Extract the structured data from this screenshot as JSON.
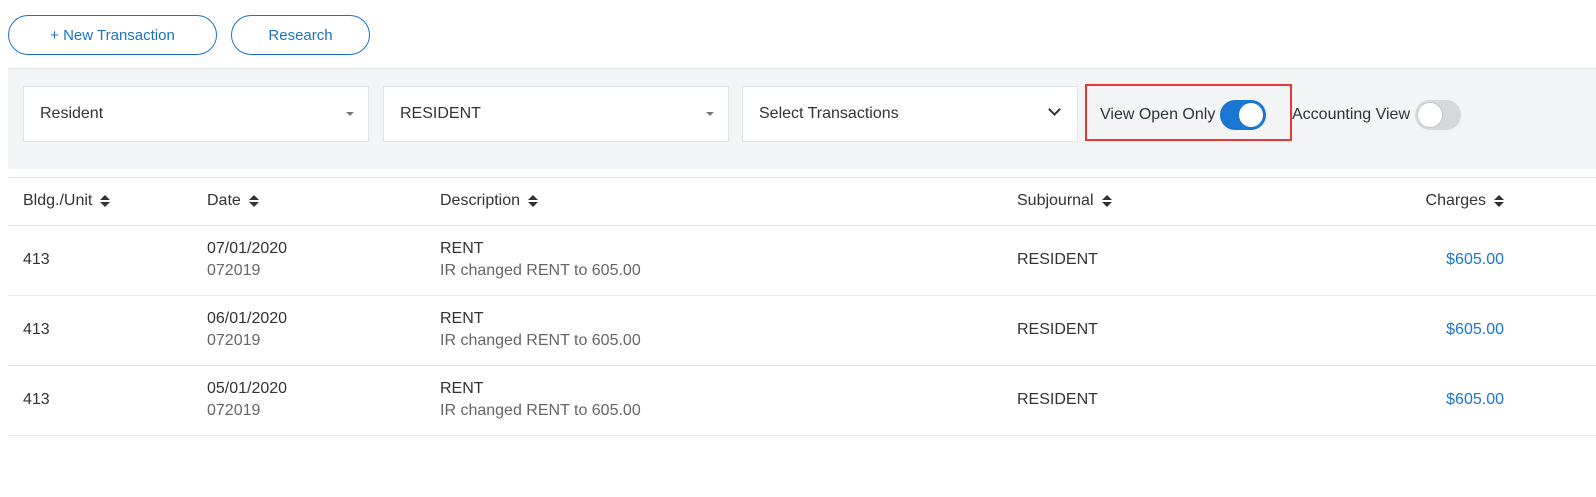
{
  "toolbar": {
    "new_transaction_label": "+ New Transaction",
    "research_label": "Research"
  },
  "filters": {
    "resident_type": "Resident",
    "subjournal": "RESIDENT",
    "transactions": "Select Transactions",
    "view_open_only_label": "View Open Only",
    "view_open_only_on": true,
    "accounting_view_label": "Accounting View",
    "accounting_view_on": false
  },
  "table": {
    "columns": {
      "unit": "Bldg./Unit",
      "date": "Date",
      "description": "Description",
      "subjournal": "Subjournal",
      "charges": "Charges"
    },
    "rows": [
      {
        "unit": "413",
        "date": "07/01/2020",
        "batch": "072019",
        "description": "RENT",
        "note": "IR changed RENT to 605.00",
        "subjournal": "RESIDENT",
        "charges": "$605.00"
      },
      {
        "unit": "413",
        "date": "06/01/2020",
        "batch": "072019",
        "description": "RENT",
        "note": "IR changed RENT to 605.00",
        "subjournal": "RESIDENT",
        "charges": "$605.00"
      },
      {
        "unit": "413",
        "date": "05/01/2020",
        "batch": "072019",
        "description": "RENT",
        "note": "IR changed RENT to 605.00",
        "subjournal": "RESIDENT",
        "charges": "$605.00"
      }
    ]
  },
  "colors": {
    "accent": "#1976d2",
    "highlight": "#e53935",
    "filter_bar_bg": "#f2f4f6"
  }
}
